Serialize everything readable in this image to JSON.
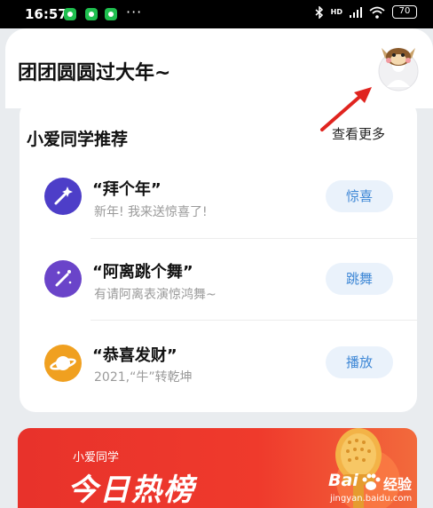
{
  "status_bar": {
    "time": "16:57",
    "more": "···",
    "network": "HD",
    "battery": "70"
  },
  "header": {
    "title": "团团圆圆过大年~"
  },
  "recommend": {
    "title": "小爱同学推荐",
    "more_label": "查看更多",
    "items": [
      {
        "title": "“拜个年”",
        "subtitle": "新年! 我来送惊喜了!",
        "button": "惊喜",
        "icon": "magic-wand-icon",
        "icon_color": "#4d3ec8"
      },
      {
        "title": "“阿离跳个舞”",
        "subtitle": "有请阿离表演惊鸿舞~",
        "button": "跳舞",
        "icon": "sparkle-wand-icon",
        "icon_color": "#6a44c9"
      },
      {
        "title": "“恭喜发财”",
        "subtitle": "2021,“牛”转乾坤",
        "button": "播放",
        "icon": "planet-icon",
        "icon_color": "#f0a020"
      }
    ]
  },
  "hot_list": {
    "small_label": "小爱同学",
    "big_label": "今日热榜"
  },
  "watermark": {
    "logo": "Bai",
    "logo_tail": "经验",
    "url": "jingyan.baidu.com"
  },
  "colors": {
    "accent_button_bg": "#eaf2fb",
    "accent_button_text": "#3d87d6",
    "banner_red": "#e8322b",
    "arrow_red": "#e0241f"
  }
}
